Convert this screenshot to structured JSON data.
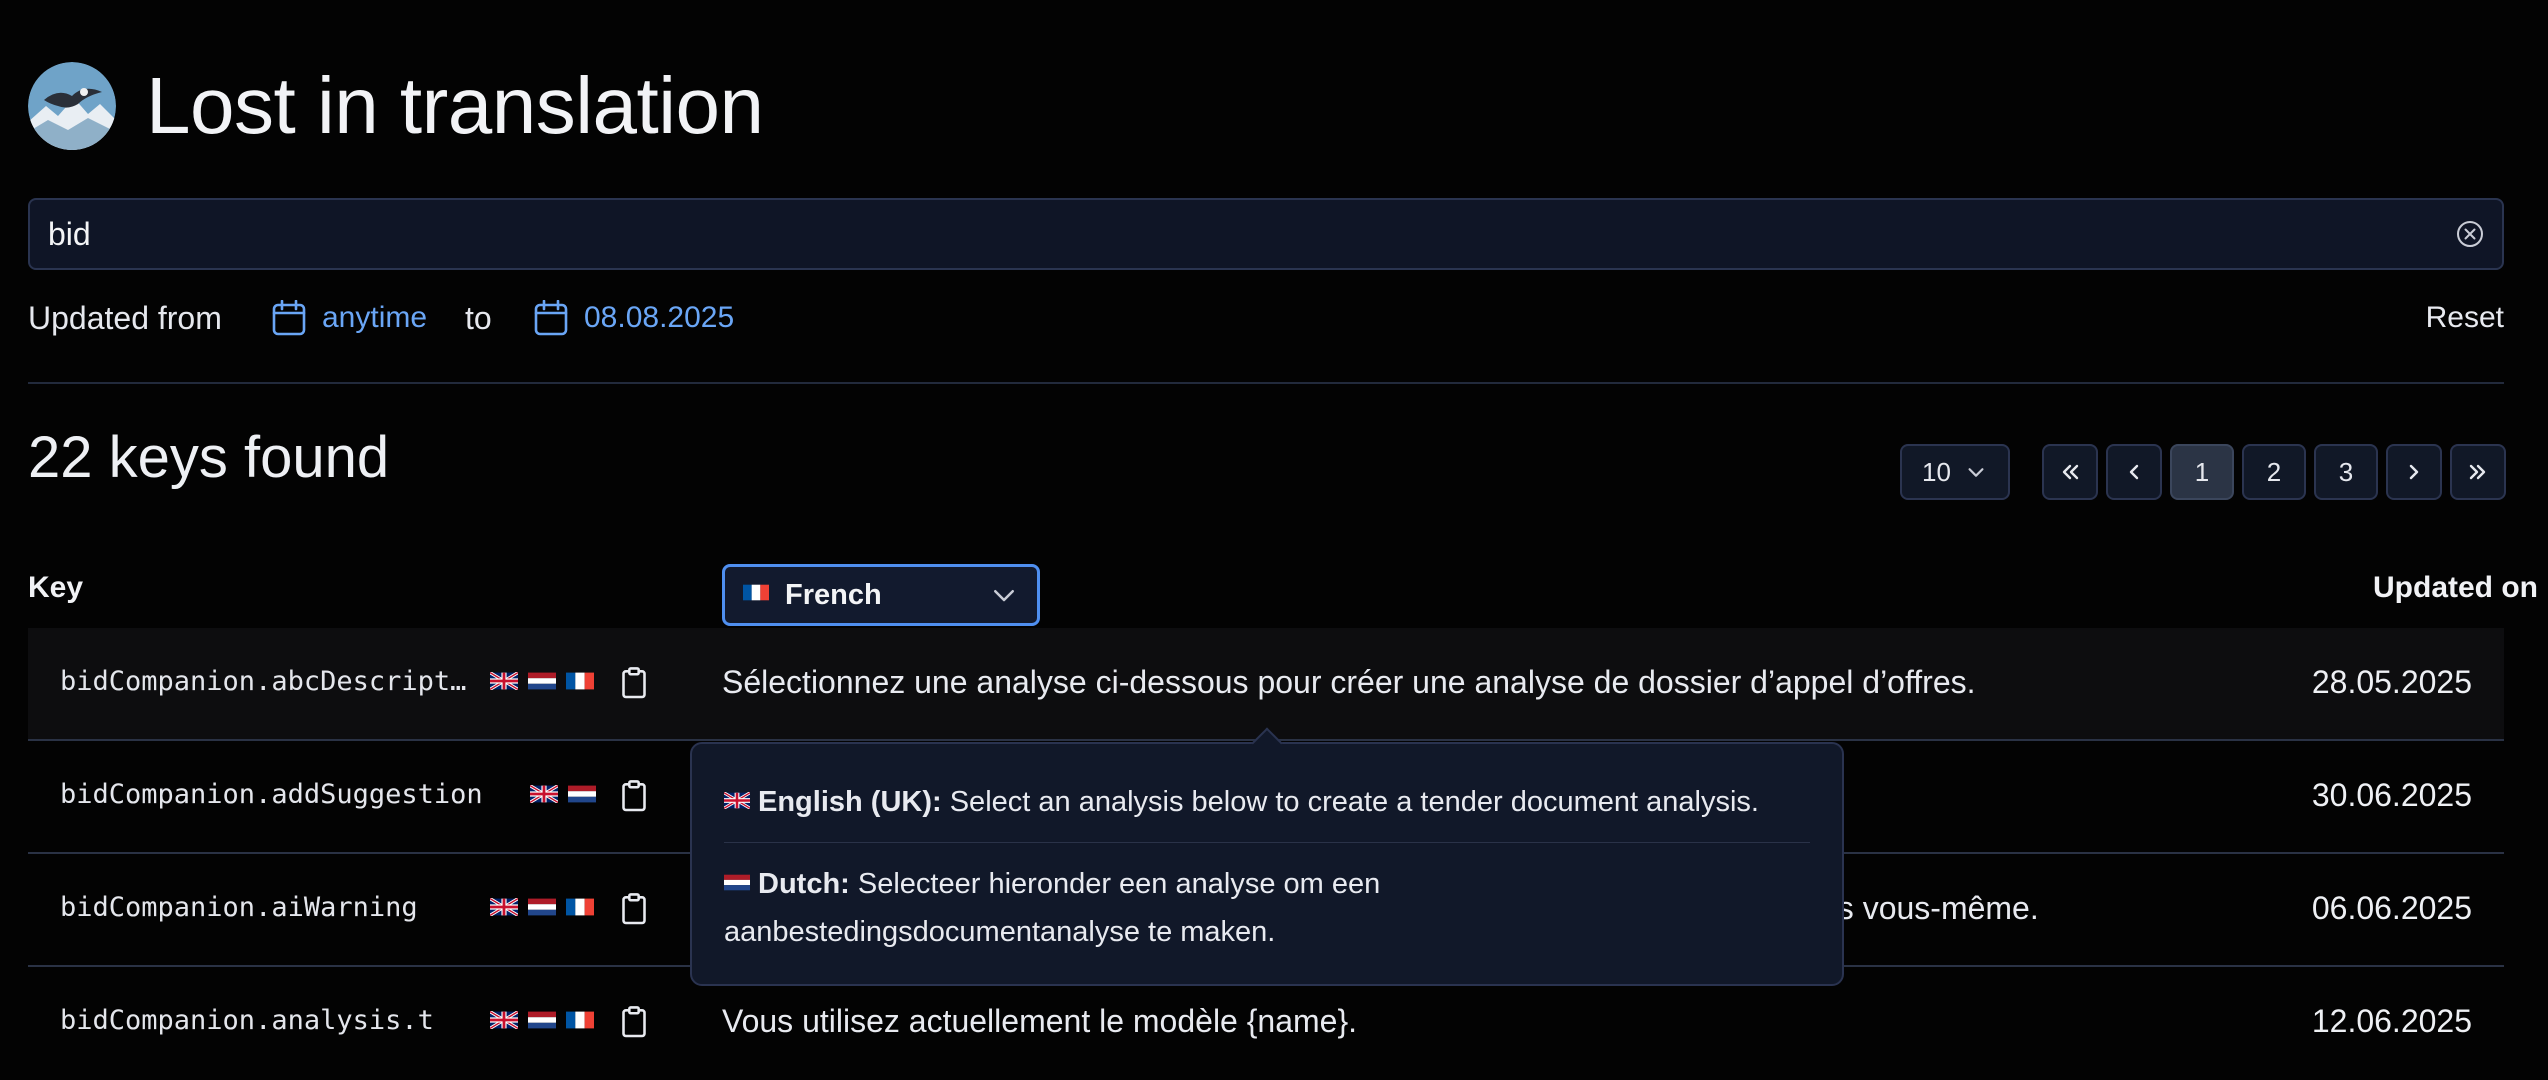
{
  "app": {
    "title": "Lost in translation"
  },
  "search": {
    "value": "bid",
    "placeholder": ""
  },
  "filters": {
    "updated_from_label": "Updated from",
    "from_value": "anytime",
    "to_label": "to",
    "to_value": "08.08.2025",
    "reset_label": "Reset"
  },
  "results": {
    "count_text": "22 keys found"
  },
  "pagination": {
    "page_size": "10",
    "pages": [
      "1",
      "2",
      "3"
    ],
    "current_page": "1"
  },
  "table": {
    "col_key": "Key",
    "language_select": "French",
    "col_updated": "Updated on",
    "rows": [
      {
        "key": "bidCompanion.abcDescription",
        "flags": [
          "uk",
          "nl",
          "fr"
        ],
        "value": "Sélectionnez une analyse ci-dessous pour créer une analyse de dossier d’appel d’offres.",
        "updated": "28.05.2025"
      },
      {
        "key": "bidCompanion.addSuggestion",
        "flags": [
          "uk",
          "nl"
        ],
        "value": "",
        "updated": "30.06.2025"
      },
      {
        "key": "bidCompanion.aiWarning",
        "flags": [
          "uk",
          "nl",
          "fr"
        ],
        "value": "es vous-même.",
        "updated": "06.06.2025"
      },
      {
        "key": "bidCompanion.analysis.t",
        "flags": [
          "uk",
          "nl",
          "fr"
        ],
        "value": "Vous utilisez actuellement le modèle {name}.",
        "updated": "12.06.2025"
      }
    ]
  },
  "tooltip": {
    "english_label": "English (UK):",
    "english_text": "Select an analysis below to create a tender document analysis.",
    "dutch_label": "Dutch:",
    "dutch_text_line1": "Selecteer hieronder een analyse om een",
    "dutch_text_line2": "aanbestedingsdocumentanalyse te maken."
  },
  "colors": {
    "accent": "#6aa6f6",
    "background": "#030303",
    "focus_border": "#4f8ff0"
  }
}
